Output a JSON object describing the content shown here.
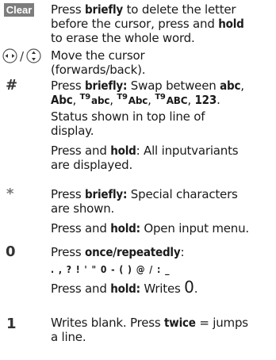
{
  "rows": {
    "clear": {
      "key_label": "Clear",
      "line1_a": "Press ",
      "line1_b": "briefly",
      "line1_c": " to delete the letter",
      "line2": "before the cursor, press and ",
      "line2_b": "hold",
      "line3": "to erase the whole word."
    },
    "nav": {
      "slash": "/",
      "line1": "Move the cursor",
      "line2": "(forwards/back)."
    },
    "hash": {
      "key_label": "#",
      "l1_a": "Press ",
      "l1_b": "briefly:",
      "l1_c": " Swap between ",
      "l1_d": "abc",
      "l2_a": "Abc",
      "l2_b": "T9",
      "l2_c": "abc",
      "l2_d": "T9",
      "l2_e": "Abc",
      "l2_f": "T9",
      "l2_g": "ABC",
      "l2_h": "123",
      "l3": "Status shown in top line of",
      "l4": "display.",
      "l5_a": "Press and ",
      "l5_b": "hold",
      "l5_c": ": All inputvariants",
      "l6": "are displayed."
    },
    "star": {
      "key_label": "*",
      "l1_a": "Press ",
      "l1_b": "briefly:",
      "l1_c": " Special characters",
      "l2": "are shown.",
      "l3_a": "Press and ",
      "l3_b": "hold:",
      "l3_c": " Open input menu."
    },
    "zero": {
      "key_label": "0",
      "l1_a": "Press ",
      "l1_b": "once/repeatedly",
      "l1_c": ":",
      "l2": ". , ? ! ' \" 0 - ( ) @ / : _",
      "l3_a": "Press and ",
      "l3_b": "hold:",
      "l3_c": " Writes ",
      "l3_d": "0",
      "l3_e": "."
    },
    "one": {
      "key_label": "1",
      "l1_a": "Writes blank. Press ",
      "l1_b": "twice",
      "l1_c": " = jumps",
      "l2": "a line."
    }
  }
}
